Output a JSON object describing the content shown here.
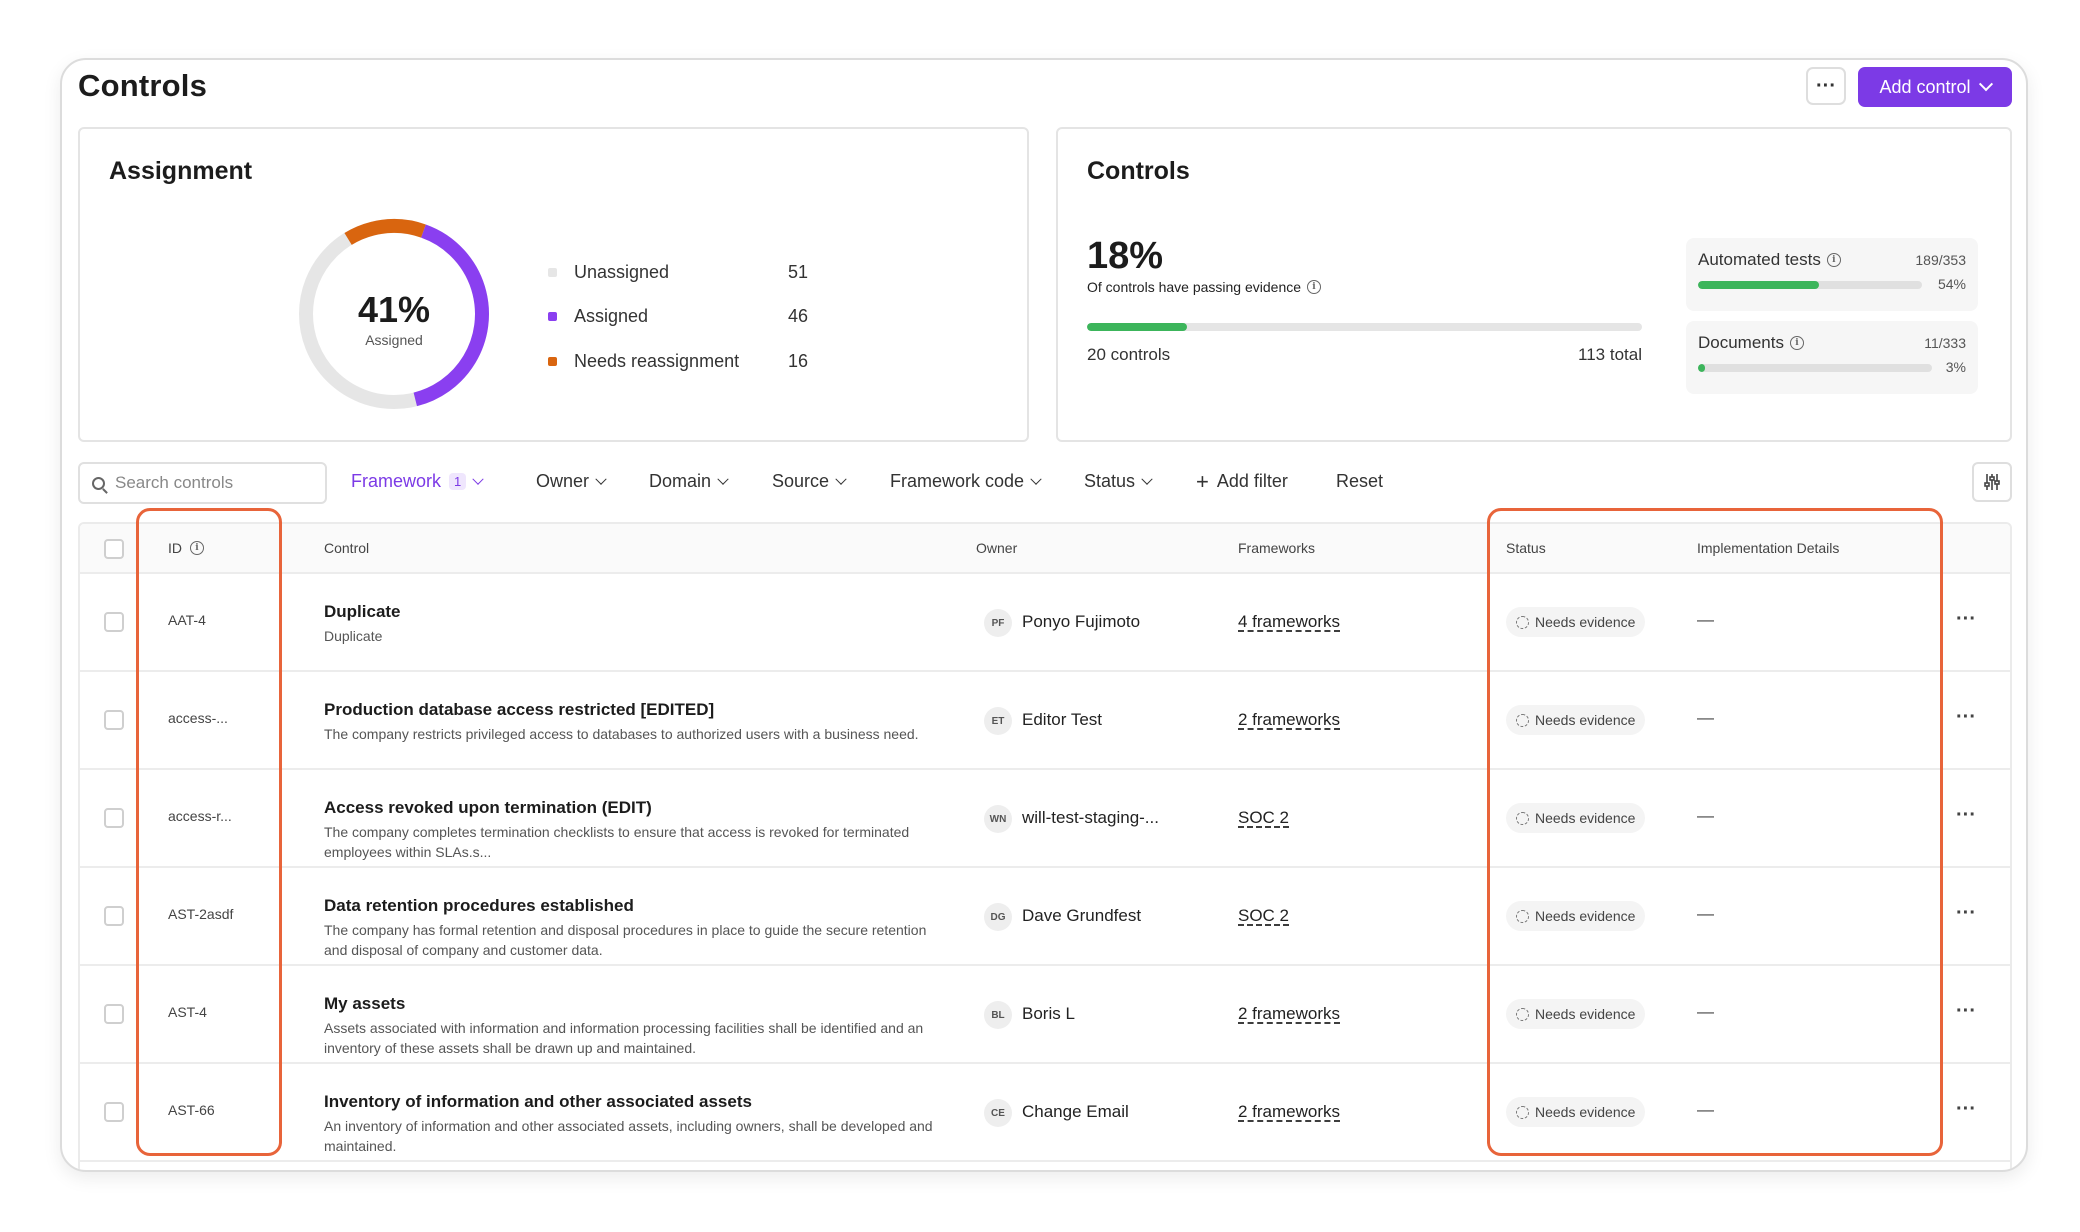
{
  "header": {
    "title": "Controls",
    "more_label": "···",
    "add_label": "Add control"
  },
  "assignment": {
    "title": "Assignment",
    "percent": "41%",
    "sub": "Assigned",
    "legend": [
      {
        "label": "Unassigned",
        "value": "51",
        "color": "#e6e6e6"
      },
      {
        "label": "Assigned",
        "value": "46",
        "color": "#8a3ff0"
      },
      {
        "label": "Needs reassignment",
        "value": "16",
        "color": "#d9650f"
      }
    ]
  },
  "controls_card": {
    "title": "Controls",
    "percent": "18%",
    "sub": "Of controls have passing evidence",
    "progress": 0.18,
    "left_label": "20 controls",
    "right_label": "113 total",
    "automated": {
      "label": "Automated tests",
      "count": "189/353",
      "pct": "54%",
      "progress": 0.54
    },
    "documents": {
      "label": "Documents",
      "count": "11/333",
      "pct": "3%",
      "progress": 0.03
    }
  },
  "filters": {
    "search_placeholder": "Search controls",
    "framework": "Framework",
    "framework_count": "1",
    "owner": "Owner",
    "domain": "Domain",
    "source": "Source",
    "framework_code": "Framework code",
    "status": "Status",
    "add_filter": "Add filter",
    "reset": "Reset"
  },
  "table": {
    "headers": {
      "id": "ID",
      "control": "Control",
      "owner": "Owner",
      "frameworks": "Frameworks",
      "status": "Status",
      "impl": "Implementation Details"
    },
    "rows": [
      {
        "id": "AAT-4",
        "title": "Duplicate",
        "desc": "Duplicate",
        "initials": "PF",
        "owner": "Ponyo Fujimoto",
        "frameworks": "4 frameworks",
        "status": "Needs evidence",
        "impl": "—"
      },
      {
        "id": "access-...",
        "title": "Production database access restricted [EDITED]",
        "desc": "The company restricts privileged access to databases to authorized users with a business need.",
        "initials": "ET",
        "owner": "Editor Test",
        "frameworks": "2 frameworks",
        "status": "Needs evidence",
        "impl": "—"
      },
      {
        "id": "access-r...",
        "title": "Access revoked upon termination (EDIT)",
        "desc": "The company completes termination checklists to ensure that access is revoked for terminated employees within SLAs.s...",
        "initials": "WN",
        "owner": "will-test-staging-...",
        "frameworks": "SOC 2",
        "status": "Needs evidence",
        "impl": "—"
      },
      {
        "id": "AST-2asdf",
        "title": "Data retention procedures established",
        "desc": "The company has formal retention and disposal procedures in place to guide the secure retention and disposal of company and customer data.",
        "initials": "DG",
        "owner": "Dave Grundfest",
        "frameworks": "SOC 2",
        "status": "Needs evidence",
        "impl": "—"
      },
      {
        "id": "AST-4",
        "title": "My assets",
        "desc": "Assets associated with information and information processing facilities shall be identified and an inventory of these assets shall be drawn up and maintained.",
        "initials": "BL",
        "owner": "Boris L",
        "frameworks": "2 frameworks",
        "status": "Needs evidence",
        "impl": "—"
      },
      {
        "id": "AST-66",
        "title": "Inventory of information and other associated assets",
        "desc": "An inventory of information and other associated assets, including owners, shall be developed and maintained.",
        "initials": "CE",
        "owner": "Change Email",
        "frameworks": "2 frameworks",
        "status": "Needs evidence",
        "impl": "—"
      }
    ]
  },
  "colors": {
    "accent": "#7c3ae6",
    "progress_green": "#3cb55b",
    "highlight": "#e8643a"
  }
}
